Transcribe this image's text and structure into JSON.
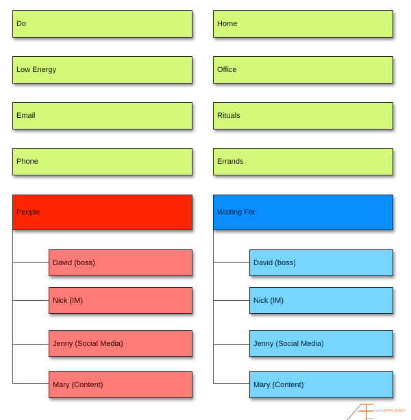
{
  "left_column": {
    "contexts": [
      "Do",
      "Low Energy",
      "Email",
      "Phone"
    ],
    "group": {
      "title": "People",
      "color": "#ff2600",
      "child_color": "#ff7b77",
      "children": [
        "David (boss)",
        "Nick (IM)",
        "Jenny (Social Media)",
        "Mary (Content)"
      ]
    }
  },
  "right_column": {
    "contexts": [
      "Home",
      "Office",
      "Rituals",
      "Errands"
    ],
    "group": {
      "title": "Waiting For",
      "color": "#0a8dff",
      "child_color": "#76d6ff",
      "children": [
        "David (boss)",
        "Nick (IM)",
        "Jenny (Social Media)",
        "Mary (Content)"
      ]
    }
  },
  "context_color": "#d4f97a",
  "logo": {
    "prefix": "ASIAN",
    "suffix": "EFFICIENCY"
  }
}
